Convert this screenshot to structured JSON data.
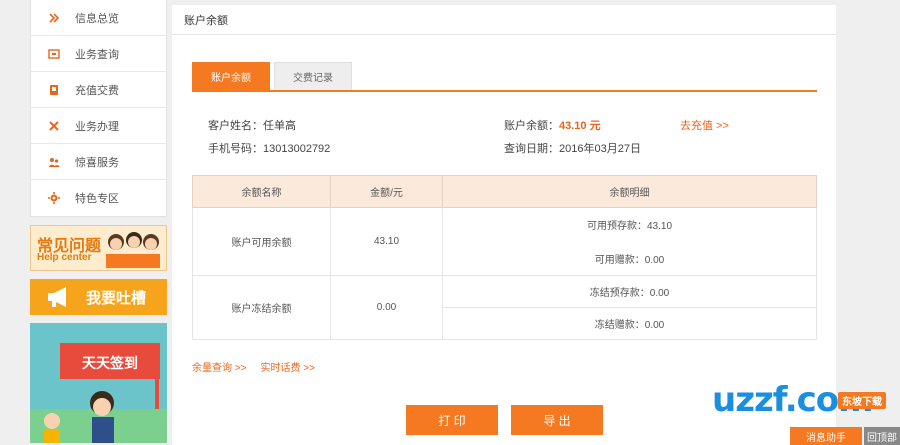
{
  "sidebar": {
    "items": [
      {
        "label": "信息总览",
        "icon": "overview-icon"
      },
      {
        "label": "业务查询",
        "icon": "query-icon"
      },
      {
        "label": "充值交费",
        "icon": "recharge-icon"
      },
      {
        "label": "业务办理",
        "icon": "tools-icon"
      },
      {
        "label": "惊喜服务",
        "icon": "users-icon"
      },
      {
        "label": "特色专区",
        "icon": "gear-icon"
      }
    ],
    "help_banner": {
      "title": "常见问题",
      "subtitle": "Help center"
    },
    "complain_banner": {
      "title": "我要吐槽"
    },
    "signin_banner": {
      "title": "天天签到"
    }
  },
  "panel": {
    "title": "账户余额",
    "tabs": [
      {
        "label": "账户余额",
        "active": true
      },
      {
        "label": "交费记录",
        "active": false
      }
    ],
    "customer_label": "客户姓名：",
    "customer_name": "任单高",
    "phone_label": "手机号码：",
    "phone": "13013002792",
    "balance_label": "账户余额：",
    "balance_value": "43.10 元",
    "recharge_link": "去充值 >>",
    "date_label": "查询日期：",
    "date_value": "2016年03月27日",
    "table": {
      "headers": [
        "余额名称",
        "金额/元",
        "余额明细"
      ],
      "rows": [
        {
          "name": "账户可用余额",
          "amount": "43.10",
          "details": [
            "可用预存款：43.10",
            "可用赠款：0.00"
          ]
        },
        {
          "name": "账户冻结余额",
          "amount": "0.00",
          "details": [
            "冻结预存款：0.00",
            "冻结赠款：0.00"
          ]
        }
      ]
    },
    "links": [
      "余量查询 >>",
      "实时话费 >>"
    ],
    "print_button": "打 印",
    "export_button": "导 出"
  },
  "watermark": {
    "logo": "uzzf.com",
    "tag": "东坡下载",
    "assistant": "消息助手",
    "top": "回顶部"
  },
  "colors": {
    "accent": "#f47920",
    "header_bg": "#fbeadb",
    "page_bg": "#efefef"
  }
}
